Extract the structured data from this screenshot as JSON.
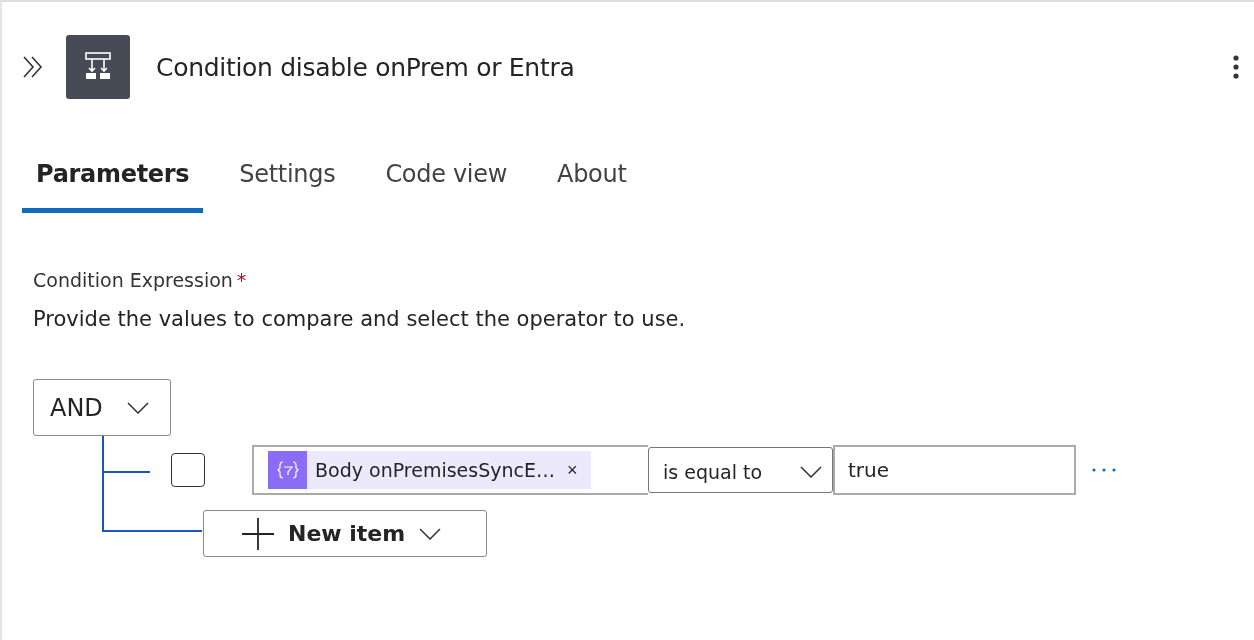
{
  "header": {
    "title": "Condition disable onPrem or Entra"
  },
  "tabs": [
    {
      "label": "Parameters",
      "selected": true
    },
    {
      "label": "Settings",
      "selected": false
    },
    {
      "label": "Code view",
      "selected": false
    },
    {
      "label": "About",
      "selected": false
    }
  ],
  "condition": {
    "label": "Condition Expression",
    "required_marker": "*",
    "description": "Provide the values to compare and select the operator to use.",
    "group_operator": "AND",
    "rows": [
      {
        "checked": false,
        "token": "Body onPremisesSyncE…",
        "token_remove": "×",
        "operator": "is equal to",
        "value": "true"
      }
    ],
    "new_item": "New item"
  }
}
